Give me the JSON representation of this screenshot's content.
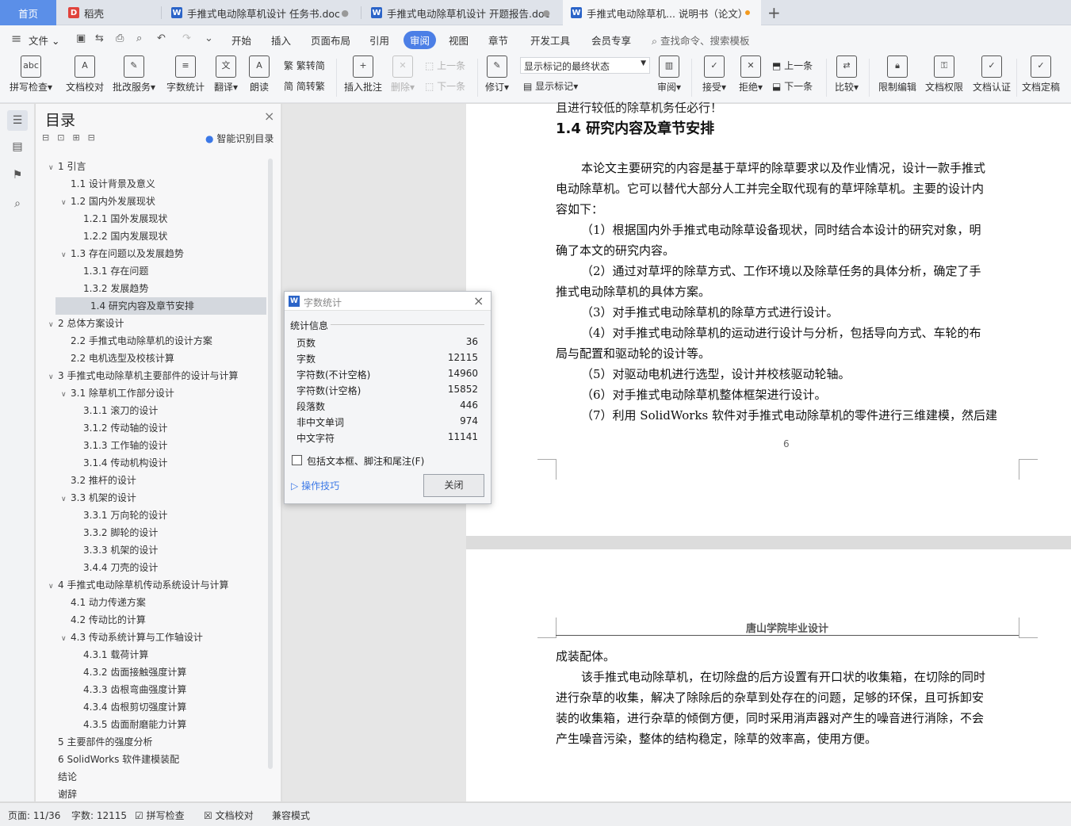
{
  "tabs": [
    {
      "label": "首页",
      "type": "home"
    },
    {
      "label": "稻壳",
      "icon": "daoke-icon"
    },
    {
      "label": "手推式电动除草机设计 任务书.doc",
      "icon": "wps-writer-icon"
    },
    {
      "label": "手推式电动除草机设计 开题报告.doc",
      "icon": "wps-writer-icon"
    },
    {
      "label": "手推式电动除草机... 说明书（论文）",
      "icon": "wps-writer-icon",
      "active": true
    }
  ],
  "menu": {
    "file": "文件",
    "items": [
      "开始",
      "插入",
      "页面布局",
      "引用",
      "审阅",
      "视图",
      "章节",
      "开发工具",
      "会员专享"
    ],
    "active": "审阅",
    "search": "查找命令、搜索模板"
  },
  "ribbon": {
    "spell": "拼写检查",
    "doc_check": "文档校对",
    "batch": "批改服务",
    "word_count": "字数统计",
    "translate": "翻译",
    "read_aloud": "朗读",
    "to_trad": "繁转简",
    "to_simp": "简转繁",
    "insert_comment": "插入批注",
    "delete": "删除",
    "prev": "上一条",
    "next": "下一条",
    "revise": "修订",
    "markup_state": "显示标记的最终状态",
    "show_markup": "显示标记",
    "review": "审阅",
    "accept": "接受",
    "reject": "拒绝",
    "prev2": "上一条",
    "next2": "下一条",
    "compare": "比较",
    "restrict": "限制编辑",
    "perm": "文档权限",
    "cert": "文档认证",
    "finalize": "文档定稿"
  },
  "toc": {
    "title": "目录",
    "smart": "智能识别目录",
    "items": [
      {
        "text": "1 引言",
        "level": 0,
        "arrow": true
      },
      {
        "text": "1.1 设计背景及意义",
        "level": 1
      },
      {
        "text": "1.2 国内外发展现状",
        "level": 1,
        "arrow": true
      },
      {
        "text": "1.2.1 国外发展现状",
        "level": 2
      },
      {
        "text": "1.2.2 国内发展现状",
        "level": 2
      },
      {
        "text": "1.3 存在问题以及发展趋势",
        "level": 1,
        "arrow": true
      },
      {
        "text": "1.3.1 存在问题",
        "level": 2
      },
      {
        "text": "1.3.2 发展趋势",
        "level": 2
      },
      {
        "text": "1.4 研究内容及章节安排",
        "level": 1,
        "selected": true
      },
      {
        "text": "2 总体方案设计",
        "level": 0,
        "arrow": true
      },
      {
        "text": "2.2 手推式电动除草机的设计方案",
        "level": 1
      },
      {
        "text": "2.2 电机选型及校核计算",
        "level": 1
      },
      {
        "text": "3 手推式电动除草机主要部件的设计与计算",
        "level": 0,
        "arrow": true
      },
      {
        "text": "3.1 除草机工作部分设计",
        "level": 1,
        "arrow": true
      },
      {
        "text": "3.1.1 滚刀的设计",
        "level": 2
      },
      {
        "text": "3.1.2 传动轴的设计",
        "level": 2
      },
      {
        "text": "3.1.3 工作轴的设计",
        "level": 2
      },
      {
        "text": "3.1.4 传动机构设计",
        "level": 2
      },
      {
        "text": "3.2 推杆的设计",
        "level": 1
      },
      {
        "text": "3.3 机架的设计",
        "level": 1,
        "arrow": true
      },
      {
        "text": "3.3.1 万向轮的设计",
        "level": 2
      },
      {
        "text": "3.3.2 脚轮的设计",
        "level": 2
      },
      {
        "text": "3.3.3 机架的设计",
        "level": 2
      },
      {
        "text": "3.4.4 刀壳的设计",
        "level": 2
      },
      {
        "text": "4 手推式电动除草机传动系统设计与计算",
        "level": 0,
        "arrow": true
      },
      {
        "text": "4.1 动力传递方案",
        "level": 1
      },
      {
        "text": "4.2 传动比的计算",
        "level": 1
      },
      {
        "text": "4.3 传动系统计算与工作轴设计",
        "level": 1,
        "arrow": true
      },
      {
        "text": "4.3.1 载荷计算",
        "level": 2
      },
      {
        "text": "4.3.2 齿面接触强度计算",
        "level": 2
      },
      {
        "text": "4.3.3 齿根弯曲强度计算",
        "level": 2
      },
      {
        "text": "4.3.4 齿根剪切强度计算",
        "level": 2
      },
      {
        "text": "4.3.5 齿面耐磨能力计算",
        "level": 2
      },
      {
        "text": "5 主要部件的强度分析",
        "level": 0
      },
      {
        "text": "6 SolidWorks 软件建模装配",
        "level": 0
      },
      {
        "text": "结论",
        "level": 0
      },
      {
        "text": "谢辞",
        "level": 0
      }
    ]
  },
  "doc": {
    "top_fragment": "且进行较低的除草机务任必行！",
    "heading": "1.4 研究内容及章节安排",
    "lines": [
      "本论文主要研究的内容是基于草坪的除草要求以及作业情况，设计一款手推式",
      "电动除草机。它可以替代大部分人工并完全取代现有的草坪除草机。主要的设计内",
      "容如下：",
      "（1）根据国内外手推式电动除草设备现状，同时结合本设计的研究对象，明",
      "确了本文的研究内容。",
      "（2）通过对草坪的除草方式、工作环境以及除草任务的具体分析，确定了手",
      "推式电动除草机的具体方案。",
      "（3）对手推式电动除草机的除草方式进行设计。",
      "（4）对手推式电动除草机的运动进行设计与分析，包括导向方式、车轮的布",
      "局与配置和驱动轮的设计等。",
      "（5）对驱动电机进行选型，设计并校核驱动轮轴。",
      "（6）对手推式电动除草机整体框架进行设计。",
      "（7）利用 SolidWorks 软件对手推式电动除草机的零件进行三维建模，然后建"
    ],
    "page_number": "6",
    "header": "唐山学院毕业设计",
    "lines2": [
      "成装配体。",
      "该手推式电动除草机，在切除盘的后方设置有开口状的收集箱，在切除的同时",
      "进行杂草的收集，解决了除除后的杂草到处存在的问题，足够的环保，且可拆卸安",
      "装的收集箱，进行杂草的倾倒方便，同时采用消声器对产生的噪音进行消除，不会",
      "产生噪音污染，整体的结构稳定，除草的效率高，使用方便。"
    ]
  },
  "dialog": {
    "title": "字数统计",
    "section": "统计信息",
    "rows": [
      {
        "label": "页数",
        "value": "36"
      },
      {
        "label": "字数",
        "value": "12115"
      },
      {
        "label": "字符数(不计空格)",
        "value": "14960"
      },
      {
        "label": "字符数(计空格)",
        "value": "15852"
      },
      {
        "label": "段落数",
        "value": "446"
      },
      {
        "label": "非中文单词",
        "value": "974"
      },
      {
        "label": "中文字符",
        "value": "11141"
      }
    ],
    "checkbox": "包括文本框、脚注和尾注(F)",
    "tips": "操作技巧",
    "close": "关闭"
  },
  "status": {
    "page": "页面: 11/36",
    "words": "字数: 12115",
    "spell": "拼写检查",
    "doccheck": "文档校对",
    "compat": "兼容模式"
  }
}
